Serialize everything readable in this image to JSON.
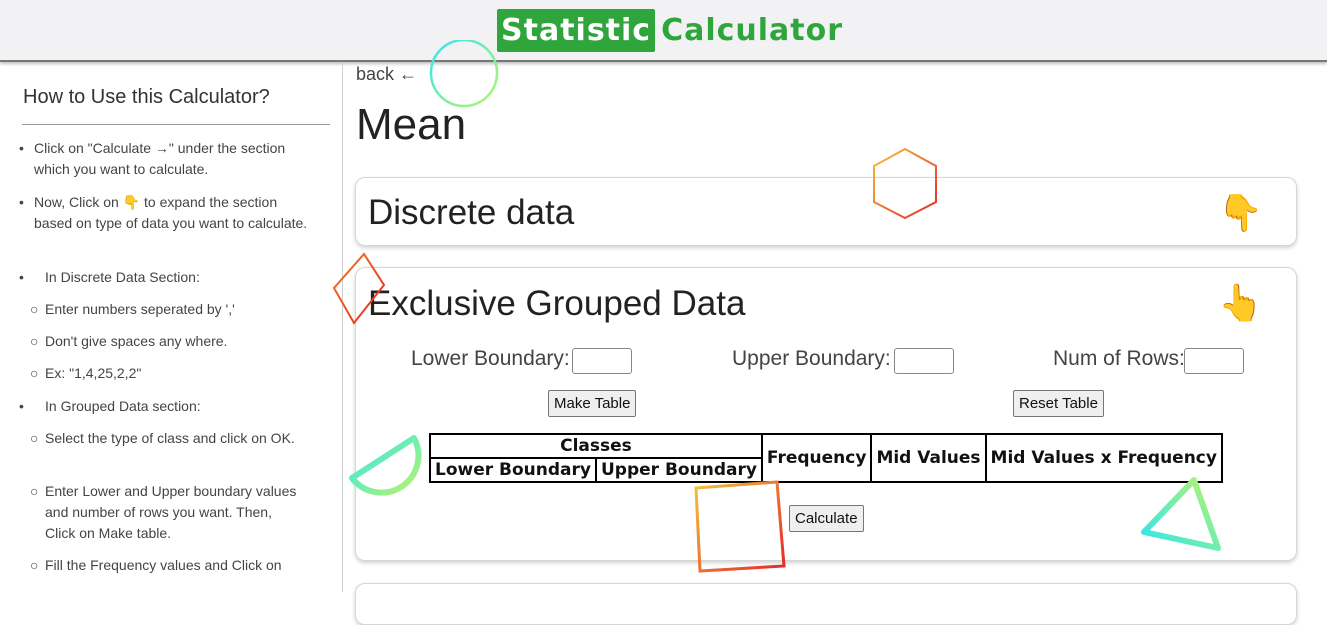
{
  "header": {
    "logo_box": "Statistic",
    "logo_rest": "Calculator"
  },
  "sidebar": {
    "title": "How to Use this Calculator?",
    "items": [
      {
        "bullet": "•",
        "text": "Click on \"Calculate →\" under the section which you want to calculate."
      },
      {
        "bullet": "•",
        "text": "Now, Click on 👇 to expand the section based on type of data you want to calculate."
      },
      {
        "bullet": "•",
        "text": "In Discrete Data Section:"
      },
      {
        "bullet": "○",
        "text": "Enter numbers seperated by ','"
      },
      {
        "bullet": "○",
        "text": "Don't give spaces any where."
      },
      {
        "bullet": "○",
        "text": "Ex: \"1,4,25,2,2\""
      },
      {
        "bullet": "•",
        "text": "In Grouped Data section:"
      },
      {
        "bullet": "○",
        "text": "Select the type of class and click on OK."
      },
      {
        "bullet": "○",
        "text": "Enter Lower and Upper boundary values and number of rows you want. Then, Click on Make table."
      },
      {
        "bullet": "○",
        "text": "Fill the Frequency values and Click on"
      }
    ]
  },
  "main": {
    "back": "back ←",
    "title": "Mean",
    "discrete": {
      "title": "Discrete data",
      "hand": "👇"
    },
    "grouped": {
      "title": "Exclusive Grouped Data",
      "hand": "👆",
      "lower_label": "Lower Boundary:",
      "upper_label": "Upper Boundary:",
      "rows_label": "Num of Rows:",
      "lower_value": "",
      "upper_value": "",
      "rows_value": "",
      "make_table": "Make Table",
      "reset_table": "Reset Table",
      "table": {
        "classes": "Classes",
        "lower_boundary": "Lower Boundary",
        "upper_boundary": "Upper Boundary",
        "frequency": "Frequency",
        "mid_values": "Mid Values",
        "mid_x_freq": "Mid Values x Frequency"
      },
      "calculate": "Calculate"
    }
  },
  "colors": {
    "brand_green": "#2fa63c"
  }
}
